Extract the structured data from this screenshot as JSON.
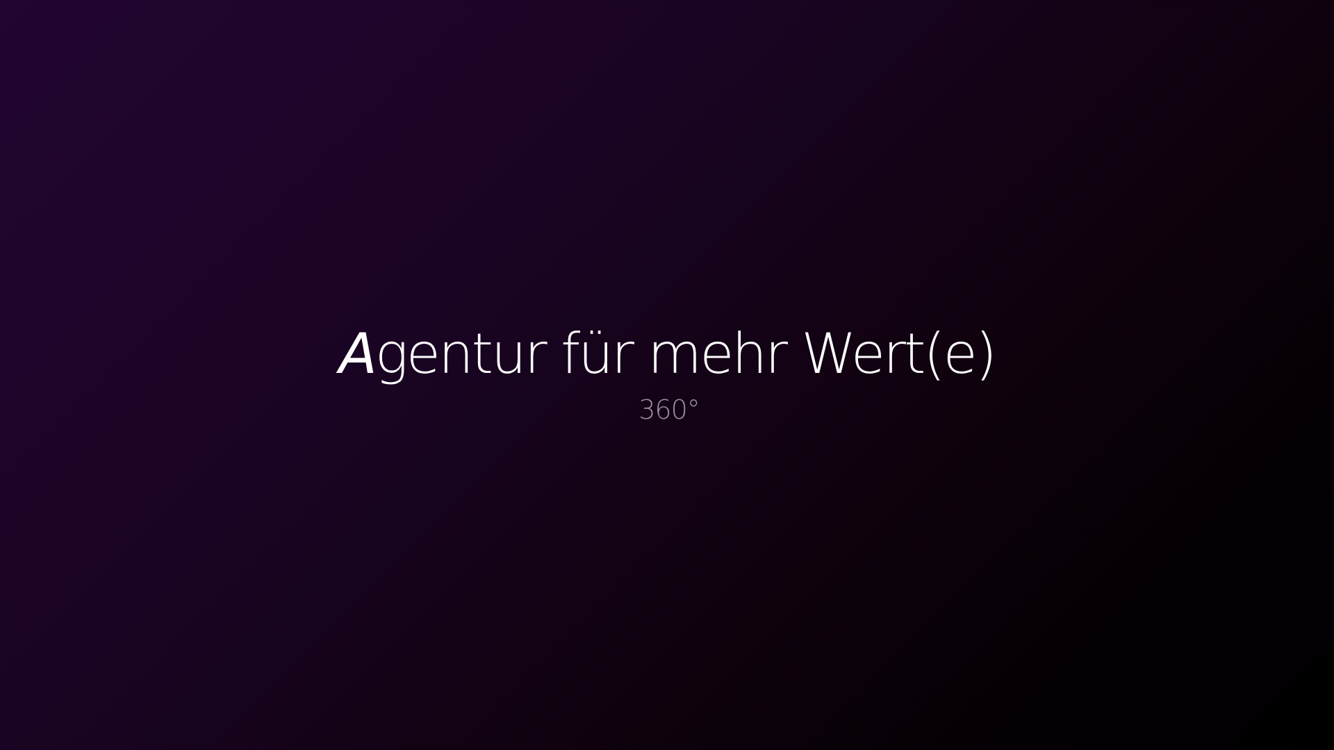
{
  "hero": {
    "title_initial": "A",
    "title_rest": "gentur für mehr Wert(e)",
    "subtitle": "360°"
  },
  "colors": {
    "background_start": "#220530",
    "background_end": "#000000",
    "title_color": "#ffffff",
    "subtitle_color": "#9a92a0"
  }
}
